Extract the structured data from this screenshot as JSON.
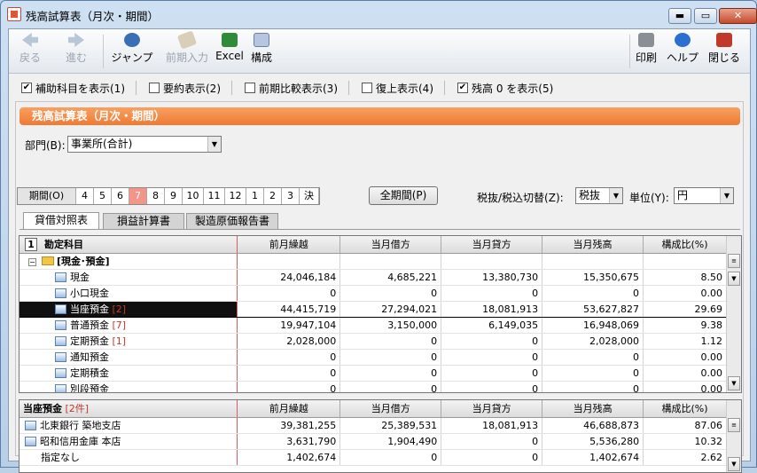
{
  "window": {
    "title": "残高試算表（月次・期間）",
    "minimize": "▬",
    "restore": "▭",
    "close": "✕"
  },
  "toolbar": {
    "back": "戻る",
    "forward": "進む",
    "jump": "ジャンプ",
    "prev_input": "前期入力",
    "excel": "Excel",
    "layout": "構成",
    "print": "印刷",
    "help": "ヘルプ",
    "close": "閉じる"
  },
  "options": [
    {
      "label": "補助科目を表示(1)",
      "checked": true
    },
    {
      "label": "要約表示(2)",
      "checked": false
    },
    {
      "label": "前期比較表示(3)",
      "checked": false
    },
    {
      "label": "復上表示(4)",
      "checked": false
    },
    {
      "label": "残高 0 を表示(5)",
      "checked": true
    }
  ],
  "panel_title": "残高試算表（月次・期間）",
  "dept": {
    "label": "部門(B):",
    "value": "事業所(合計)"
  },
  "periods": {
    "label": "期間(O)",
    "months": [
      "4",
      "5",
      "6",
      "7",
      "8",
      "9",
      "10",
      "11",
      "12",
      "1",
      "2",
      "3",
      "決"
    ],
    "active": "7"
  },
  "all_period_button": "全期間(P)",
  "tax": {
    "label": "税抜/税込切替(Z):",
    "value": "税抜"
  },
  "unit": {
    "label": "単位(Y):",
    "value": "円"
  },
  "tabs": [
    "貸借対照表",
    "損益計算書",
    "製造原価報告書"
  ],
  "main_table": {
    "num": "1",
    "headers": [
      "勘定科目",
      "前月繰越",
      "当月借方",
      "当月貸方",
      "当月残高",
      "構成比(%)"
    ],
    "group": "[現金･預金]",
    "rows": [
      {
        "name": "現金",
        "count": "",
        "v": [
          "24,046,184",
          "4,685,221",
          "13,380,730",
          "15,350,675",
          "8.50"
        ]
      },
      {
        "name": "小口現金",
        "count": "",
        "v": [
          "0",
          "0",
          "0",
          "0",
          "0.00"
        ]
      },
      {
        "name": "当座預金",
        "count": "[2]",
        "v": [
          "44,415,719",
          "27,294,021",
          "18,081,913",
          "53,627,827",
          "29.69"
        ],
        "selected": true
      },
      {
        "name": "普通預金",
        "count": "[7]",
        "v": [
          "19,947,104",
          "3,150,000",
          "6,149,035",
          "16,948,069",
          "9.38"
        ]
      },
      {
        "name": "定期預金",
        "count": "[1]",
        "v": [
          "2,028,000",
          "0",
          "0",
          "2,028,000",
          "1.12"
        ]
      },
      {
        "name": "通知預金",
        "count": "",
        "v": [
          "0",
          "0",
          "0",
          "0",
          "0.00"
        ]
      },
      {
        "name": "定期積金",
        "count": "",
        "v": [
          "0",
          "0",
          "0",
          "0",
          "0.00"
        ]
      },
      {
        "name": "別段預金",
        "count": "",
        "v": [
          "0",
          "0",
          "0",
          "0",
          "0.00"
        ]
      }
    ]
  },
  "sub_table": {
    "title": "当座預金",
    "count": "[2件]",
    "headers": [
      "前月繰越",
      "当月借方",
      "当月貸方",
      "当月残高",
      "構成比(%)"
    ],
    "rows": [
      {
        "name": "北東銀行 築地支店",
        "icon": true,
        "v": [
          "39,381,255",
          "25,389,531",
          "18,081,913",
          "46,688,873",
          "87.06"
        ]
      },
      {
        "name": "昭和信用金庫 本店",
        "icon": true,
        "v": [
          "3,631,790",
          "1,904,490",
          "0",
          "5,536,280",
          "10.32"
        ]
      },
      {
        "name": "指定なし",
        "icon": false,
        "v": [
          "1,402,674",
          "0",
          "0",
          "1,402,674",
          "2.62"
        ]
      }
    ]
  }
}
